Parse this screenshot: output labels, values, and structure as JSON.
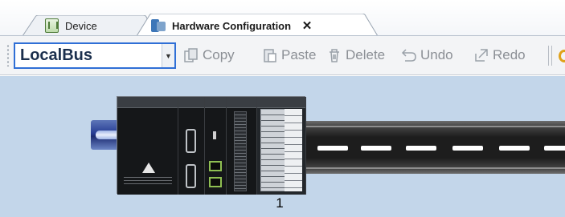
{
  "tabs": [
    {
      "label": "Device",
      "icon": "device-icon",
      "active": false
    },
    {
      "label": "Hardware Configuration",
      "icon": "hardware-config-icon",
      "active": true,
      "close_glyph": "✕"
    }
  ],
  "toolbar": {
    "bus_select": {
      "value": "LocalBus",
      "arrow": "▼"
    },
    "buttons": [
      {
        "label": "Copy",
        "icon": "copy-icon",
        "enabled": false
      },
      {
        "label": "Paste",
        "icon": "paste-icon",
        "enabled": false
      },
      {
        "label": "Delete",
        "icon": "delete-icon",
        "enabled": false
      },
      {
        "label": "Undo",
        "icon": "undo-icon",
        "enabled": false
      },
      {
        "label": "Redo",
        "icon": "redo-icon",
        "enabled": false
      }
    ]
  },
  "canvas": {
    "background": "#c3d6ea",
    "rack": {
      "slot_label": "1"
    }
  },
  "colors": {
    "accent": "#2f6fd6",
    "disabled_text": "#8b8f95"
  }
}
